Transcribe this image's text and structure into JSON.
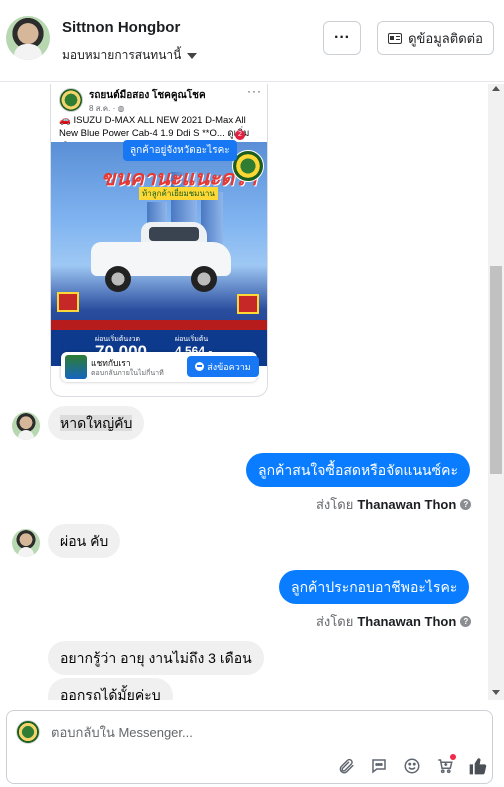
{
  "header": {
    "user_name": "Sittnon Hongbor",
    "assign_label": "มอบหมายการสนทนานี้",
    "more_label": "···",
    "contact_label": "ดูข้อมูลติดต่อ"
  },
  "post": {
    "page_name": "รถยนต์มือสอง โชคคูณโชค",
    "meta": "8 ส.ค. · ",
    "text": "🚗 ISUZU D-MAX ALL NEW 2021 D-Max All New Blue Power Cab-4 1.9 Ddi S **O... ดูเพิ่มเติม",
    "tip": "ลูกค้าอยู่จังหวัดอะไรคะ",
    "badge": "2",
    "img_title": "ขนคานะแนะดรา",
    "img_sub": "ท้าลูกค้าเยี่ยมชมนาน",
    "price_label_left": "ผ่อนเริ่มต้นงวด",
    "price_big": "70,000",
    "price_label_right": "ผ่อนเริ่มต้น",
    "price_big2": "4,564.-",
    "promo_title": "แชทกับเรา",
    "promo_sub": "ตอบกลับภายในไม่กี่นาที",
    "promo_button": "ส่งข้อความ"
  },
  "messages": [
    {
      "dir": "in",
      "text": "หาดใหญ่คับ"
    },
    {
      "dir": "out",
      "text": "ลูกค้าสนใจซื้อสดหรือจัดแนนซ์คะ",
      "sent_by_prefix": "ส่งโดย",
      "sent_by": "Thanawan Thon"
    },
    {
      "dir": "in",
      "text": "ผ่อน คับ"
    },
    {
      "dir": "out",
      "text": "ลูกค้าประกอบอาชีพอะไรคะ",
      "sent_by_prefix": "ส่งโดย",
      "sent_by": "Thanawan Thon"
    },
    {
      "dir": "in",
      "text": "อยากรู้ว่า อายุ งานไม่ถึง 3 เดือน"
    },
    {
      "dir": "in",
      "text": "ออกรถได้มั้ยค่ะบ"
    }
  ],
  "composer": {
    "placeholder": "ตอบกลับใน Messenger..."
  },
  "icons": {
    "attach": "paperclip-icon",
    "saved_replies": "chat-bubble-icon",
    "emoji": "smiley-icon",
    "cart": "cart-icon",
    "like": "thumbs-up-icon"
  },
  "colors": {
    "outgoing_bubble": "#0a7cff",
    "incoming_bubble": "#f0f0f0",
    "messenger_blue": "#1877f2"
  }
}
